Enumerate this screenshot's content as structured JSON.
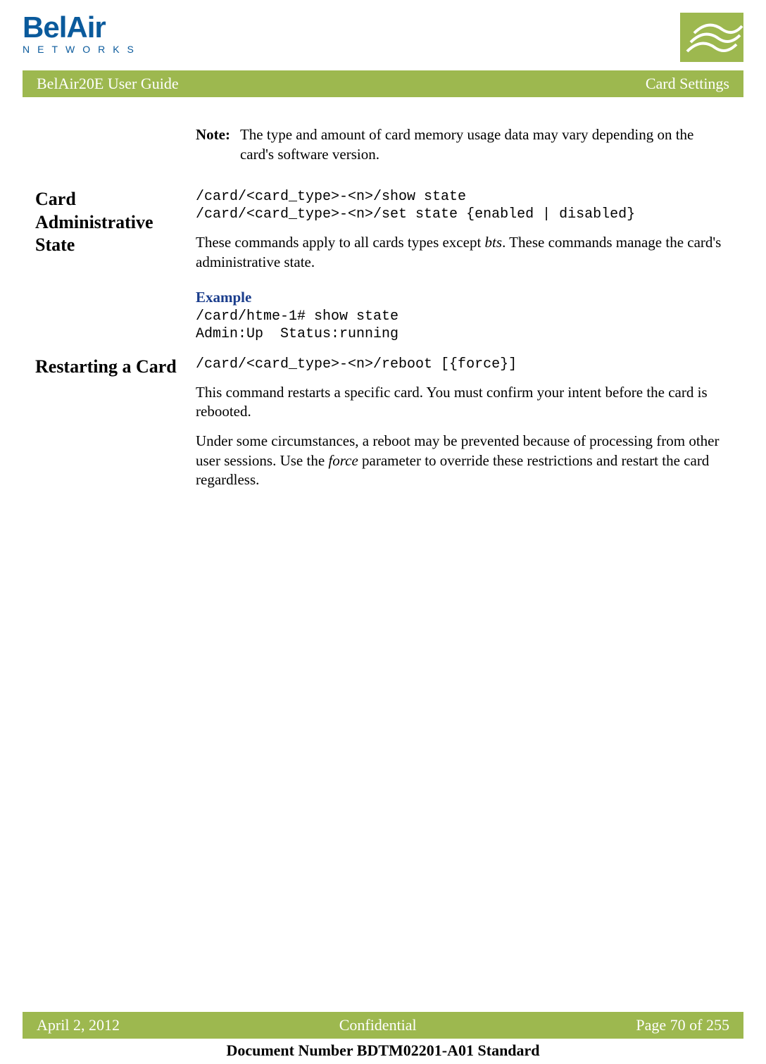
{
  "brand": {
    "name": "BelAir",
    "sub": "NETWORKS"
  },
  "titleBar": {
    "left": "BelAir20E User Guide",
    "right": "Card Settings"
  },
  "note": {
    "label": "Note:",
    "text": "The type and amount of card memory usage data may vary depending on the card's software version."
  },
  "section1": {
    "heading": "Card Administrative State",
    "code1": "/card/<card_type>-<n>/show state",
    "code2": "/card/<card_type>-<n>/set state {enabled | disabled}",
    "para_a": "These commands apply to all cards types except ",
    "para_b": "bts",
    "para_c": ". These commands manage the card's administrative state.",
    "exampleHeading": "Example",
    "exCode1": "/card/htme-1# show state",
    "exCode2": "Admin:Up  Status:running"
  },
  "section2": {
    "heading": "Restarting a Card",
    "code1": "/card/<card_type>-<n>/reboot [{force}]",
    "para1": "This command restarts a specific card. You must confirm your intent before the card is rebooted.",
    "para2a": "Under some circumstances, a reboot may be prevented because of processing from other user sessions. Use the ",
    "para2b": "force",
    "para2c": " parameter to override these restrictions and restart the card regardless."
  },
  "footer": {
    "date": "April 2, 2012",
    "center": "Confidential",
    "page": "Page 70 of 255",
    "docnum": "Document Number BDTM02201-A01 Standard"
  }
}
